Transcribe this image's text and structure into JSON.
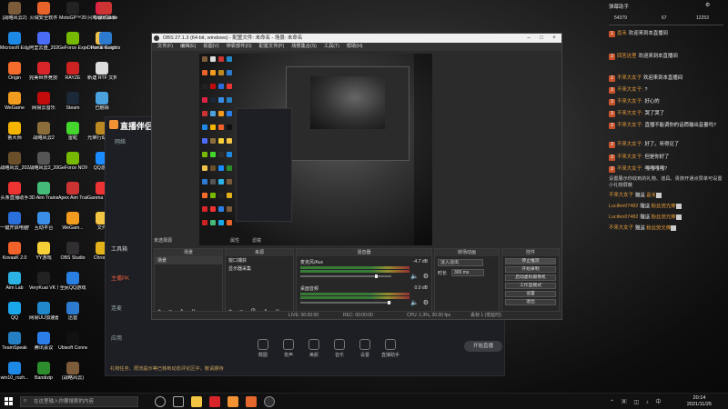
{
  "desktop": {
    "icons": [
      {
        "label": "(战略风云2)",
        "color": "#7b5b3a"
      },
      {
        "label": "火绒安全软件",
        "color": "#e8632a"
      },
      {
        "label": "MotoGP™20",
        "color": "#222"
      },
      {
        "label": "闪电看家屏录",
        "color": "#d24"
      },
      {
        "label": "Crab Game",
        "color": "#c33"
      },
      {
        "label": "Microsoft Edge",
        "color": "#1e88e5"
      },
      {
        "label": "阿里云盘_2021100...",
        "color": "#4a6cf7"
      },
      {
        "label": "GeForce Experience",
        "color": "#76b900"
      },
      {
        "label": "Draw & Guess",
        "color": "#f0c14b"
      },
      {
        "label": "Portal Knights",
        "color": "#2d7bd1"
      },
      {
        "label": "Origin",
        "color": "#f56c2d"
      },
      {
        "label": "完美世界竞技平台",
        "color": "#d7252a"
      },
      {
        "label": "RAYZE",
        "color": "#c22"
      },
      {
        "label": "新建 RTF 文档",
        "color": "#ddd"
      },
      {
        "label": "WeGame",
        "color": "#f29c1f"
      },
      {
        "label": "网易云音乐",
        "color": "#c20c0c"
      },
      {
        "label": "Steam",
        "color": "#1b2838"
      },
      {
        "label": "已删除",
        "color": "#4aa3df"
      },
      {
        "label": "鲁大师",
        "color": "#f4b400"
      },
      {
        "label": "战略风云2",
        "color": "#8a6d3b"
      },
      {
        "label": "雷蛇",
        "color": "#44d62c"
      },
      {
        "label": "战略风云_2021091...",
        "color": "#6b4f2a"
      },
      {
        "label": "战略风云2_2042",
        "color": "#555"
      },
      {
        "label": "GeForce NOW",
        "color": "#76b900"
      },
      {
        "label": "头条直播助手",
        "color": "#e33"
      },
      {
        "label": "3D Aim Trainer",
        "color": "#4b7"
      },
      {
        "label": "Apex Aim Trainer",
        "color": "#c33"
      },
      {
        "label": "光荣行动全功能版",
        "color": "#b82"
      },
      {
        "label": "一键开启电脑Windows 发行",
        "color": "#2a6fdb"
      },
      {
        "label": "互动平台",
        "color": "#3a8ee6"
      },
      {
        "label": "WeGam...",
        "color": "#f29c1f"
      },
      {
        "label": "KovaaK 2.0",
        "color": "#f1632a"
      },
      {
        "label": "YY游戏",
        "color": "#f7d038"
      },
      {
        "label": "OBS Studio",
        "color": "#302e31"
      },
      {
        "label": "QQ游戏",
        "color": "#1a8cff"
      },
      {
        "label": "Aim Lab",
        "color": "#2bb3e6"
      },
      {
        "label": "VeryKuai VK 加速器",
        "color": "#222"
      },
      {
        "label": "全民QQ游戏",
        "color": "#2a7fe3"
      },
      {
        "label": "QQ",
        "color": "#1aa7ec"
      },
      {
        "label": "网易UU加速器",
        "color": "#28c"
      },
      {
        "label": "迅雷",
        "color": "#2d7bd1"
      },
      {
        "label": "Garena Taiwan",
        "color": "#e33"
      },
      {
        "label": "TeamSpeak",
        "color": "#2580c3"
      },
      {
        "label": "腾讯会议",
        "color": "#2b7de9"
      },
      {
        "label": "Ubisoft Connect",
        "color": "#111"
      },
      {
        "label": "文件",
        "color": "#f4c542"
      },
      {
        "label": "win10_rozh...",
        "color": "#1e88e5"
      },
      {
        "label": "Bandizip",
        "color": "#2c8d2c"
      },
      {
        "label": "(战略风云)",
        "color": "#7b5b3a"
      },
      {
        "label": "Chrome",
        "color": "#e3b21b"
      }
    ]
  },
  "streamer_app": {
    "brand": "直播伴侣",
    "tab": "网络",
    "labels": {
      "tools": "工具箱",
      "pk": "主播PK",
      "lianmai": "连麦",
      "apply": "应用"
    },
    "bottom_buttons": [
      "截图",
      "变声",
      "美颜",
      "音乐",
      "设置",
      "直播助手"
    ],
    "notice": "礼物任务、限流提示等已移到动态评论区中，敬请期待",
    "start_button": "开始直播"
  },
  "obs": {
    "title": "OBS 27.1.3 (64-bit, windows) - 配置文件: 未命名 - 场景: 未命名",
    "menu": [
      "文件(F)",
      "编辑(E)",
      "视图(V)",
      "停靠部件(D)",
      "配置文件(P)",
      "场景集合(S)",
      "工具(T)",
      "帮助(H)"
    ],
    "scene_selected_label": "未选择源",
    "props_buttons": [
      "属性",
      "滤镜"
    ],
    "docks": {
      "scenes": {
        "title": "场景",
        "items": [
          "场景"
        ]
      },
      "sources": {
        "title": "来源",
        "items": [
          "窗口捕获",
          "显示器采集"
        ]
      },
      "mixer": {
        "title": "混音器",
        "tracks": [
          {
            "name": "麦克风/Aux",
            "db": "-4.7 dB"
          },
          {
            "name": "桌面音频",
            "db": "0.0 dB"
          }
        ]
      },
      "transitions": {
        "title": "转场动画",
        "type": "淡入淡出",
        "duration_label": "时长",
        "duration": "300 ms"
      },
      "controls": {
        "title": "控件",
        "buttons": [
          "停止推流",
          "开始录制",
          "启动虚拟摄像机",
          "工作室模式",
          "设置",
          "退出"
        ]
      }
    },
    "status": {
      "live": "LIVE: 00:00:00",
      "rec": "REC: 00:00:00",
      "cpu": "CPU: 1.3%, 30.00 fps",
      "dropped": "丢帧 1 (低延时)"
    }
  },
  "chat": {
    "header": "弹幕助手",
    "stats": [
      "54379",
      "67",
      "12253"
    ],
    "messages": [
      {
        "badge": "1",
        "user": "嘉禾",
        "text": "欢迎来到本直播间"
      },
      {
        "badge": "2",
        "user": "回答这里",
        "text": "欢迎来到本直播间"
      },
      {
        "badge": "2",
        "user": "不来大女子",
        "text": "欢迎来到本直播间"
      },
      {
        "badge": "3",
        "user": "不来大女子:",
        "text": "?"
      },
      {
        "badge": "3",
        "user": "不来大女子:",
        "text": "好心的"
      },
      {
        "badge": "3",
        "user": "不来大女子:",
        "text": "哭了哭了"
      },
      {
        "badge": "3",
        "user": "不来大女子:",
        "text": "直播不能调你的话筒输出音量吗?"
      },
      {
        "badge": "3",
        "user": "不来大女子:",
        "text": "好了。听得见了"
      },
      {
        "badge": "3",
        "user": "不来大女子:",
        "text": "但是你好了"
      },
      {
        "badge": "3",
        "user": "不来大女子:",
        "text": "嘎嘎嘎嘎?"
      }
    ],
    "gift_notice": "设置展示你收到的礼物、道具、贵族开通点赞单可设置小礼物屏蔽",
    "gifts": [
      {
        "user": "不来大女子",
        "action": "赠送",
        "item": "嘉禾"
      },
      {
        "user": "Lucifen07482",
        "action": "赠送",
        "item": "粉丝荧光棒"
      },
      {
        "user": "Lucifen07482",
        "action": "赠送",
        "item": "粉丝荧光棒"
      },
      {
        "user": "不来大女子",
        "action": "赠送",
        "item": "粉丝荧光棒"
      }
    ]
  },
  "taskbar": {
    "search_placeholder": "在这里输入你要搜索的内容",
    "time": "20:14",
    "date": "2021/11/25"
  }
}
